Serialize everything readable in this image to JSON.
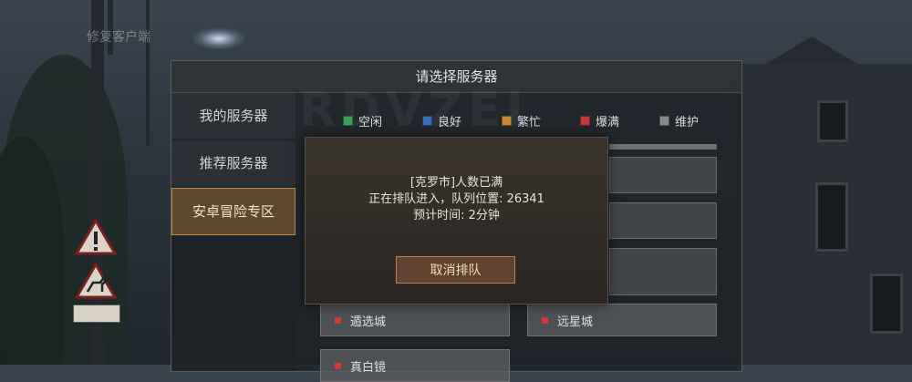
{
  "background": {
    "corner_text": "修复客户端",
    "watermark": "RDVZEI"
  },
  "panel": {
    "title": "请选择服务器"
  },
  "tabs": [
    {
      "label": "我的服务器",
      "active": false
    },
    {
      "label": "推荐服务器",
      "active": false
    },
    {
      "label": "安卓冒险专区",
      "active": true
    }
  ],
  "legend": [
    {
      "label": "空闲",
      "color": "#3aa35a"
    },
    {
      "label": "良好",
      "color": "#3b6fb5"
    },
    {
      "label": "繁忙",
      "color": "#c78a2f"
    },
    {
      "label": "爆满",
      "color": "#c23a3a"
    },
    {
      "label": "维护",
      "color": "#8a8a8a"
    }
  ],
  "servers": [
    {
      "name": "遁选城",
      "status_color": "#d33b3b"
    },
    {
      "name": "远星城",
      "status_color": "#d33b3b"
    },
    {
      "name": "真白镜",
      "status_color": "#d33b3b"
    }
  ],
  "queue_dialog": {
    "line1": "[克罗市]人数已满",
    "line2": "正在排队进入，队列位置: 26341",
    "line3": "预计时间: 2分钟",
    "cancel_label": "取消排队"
  }
}
